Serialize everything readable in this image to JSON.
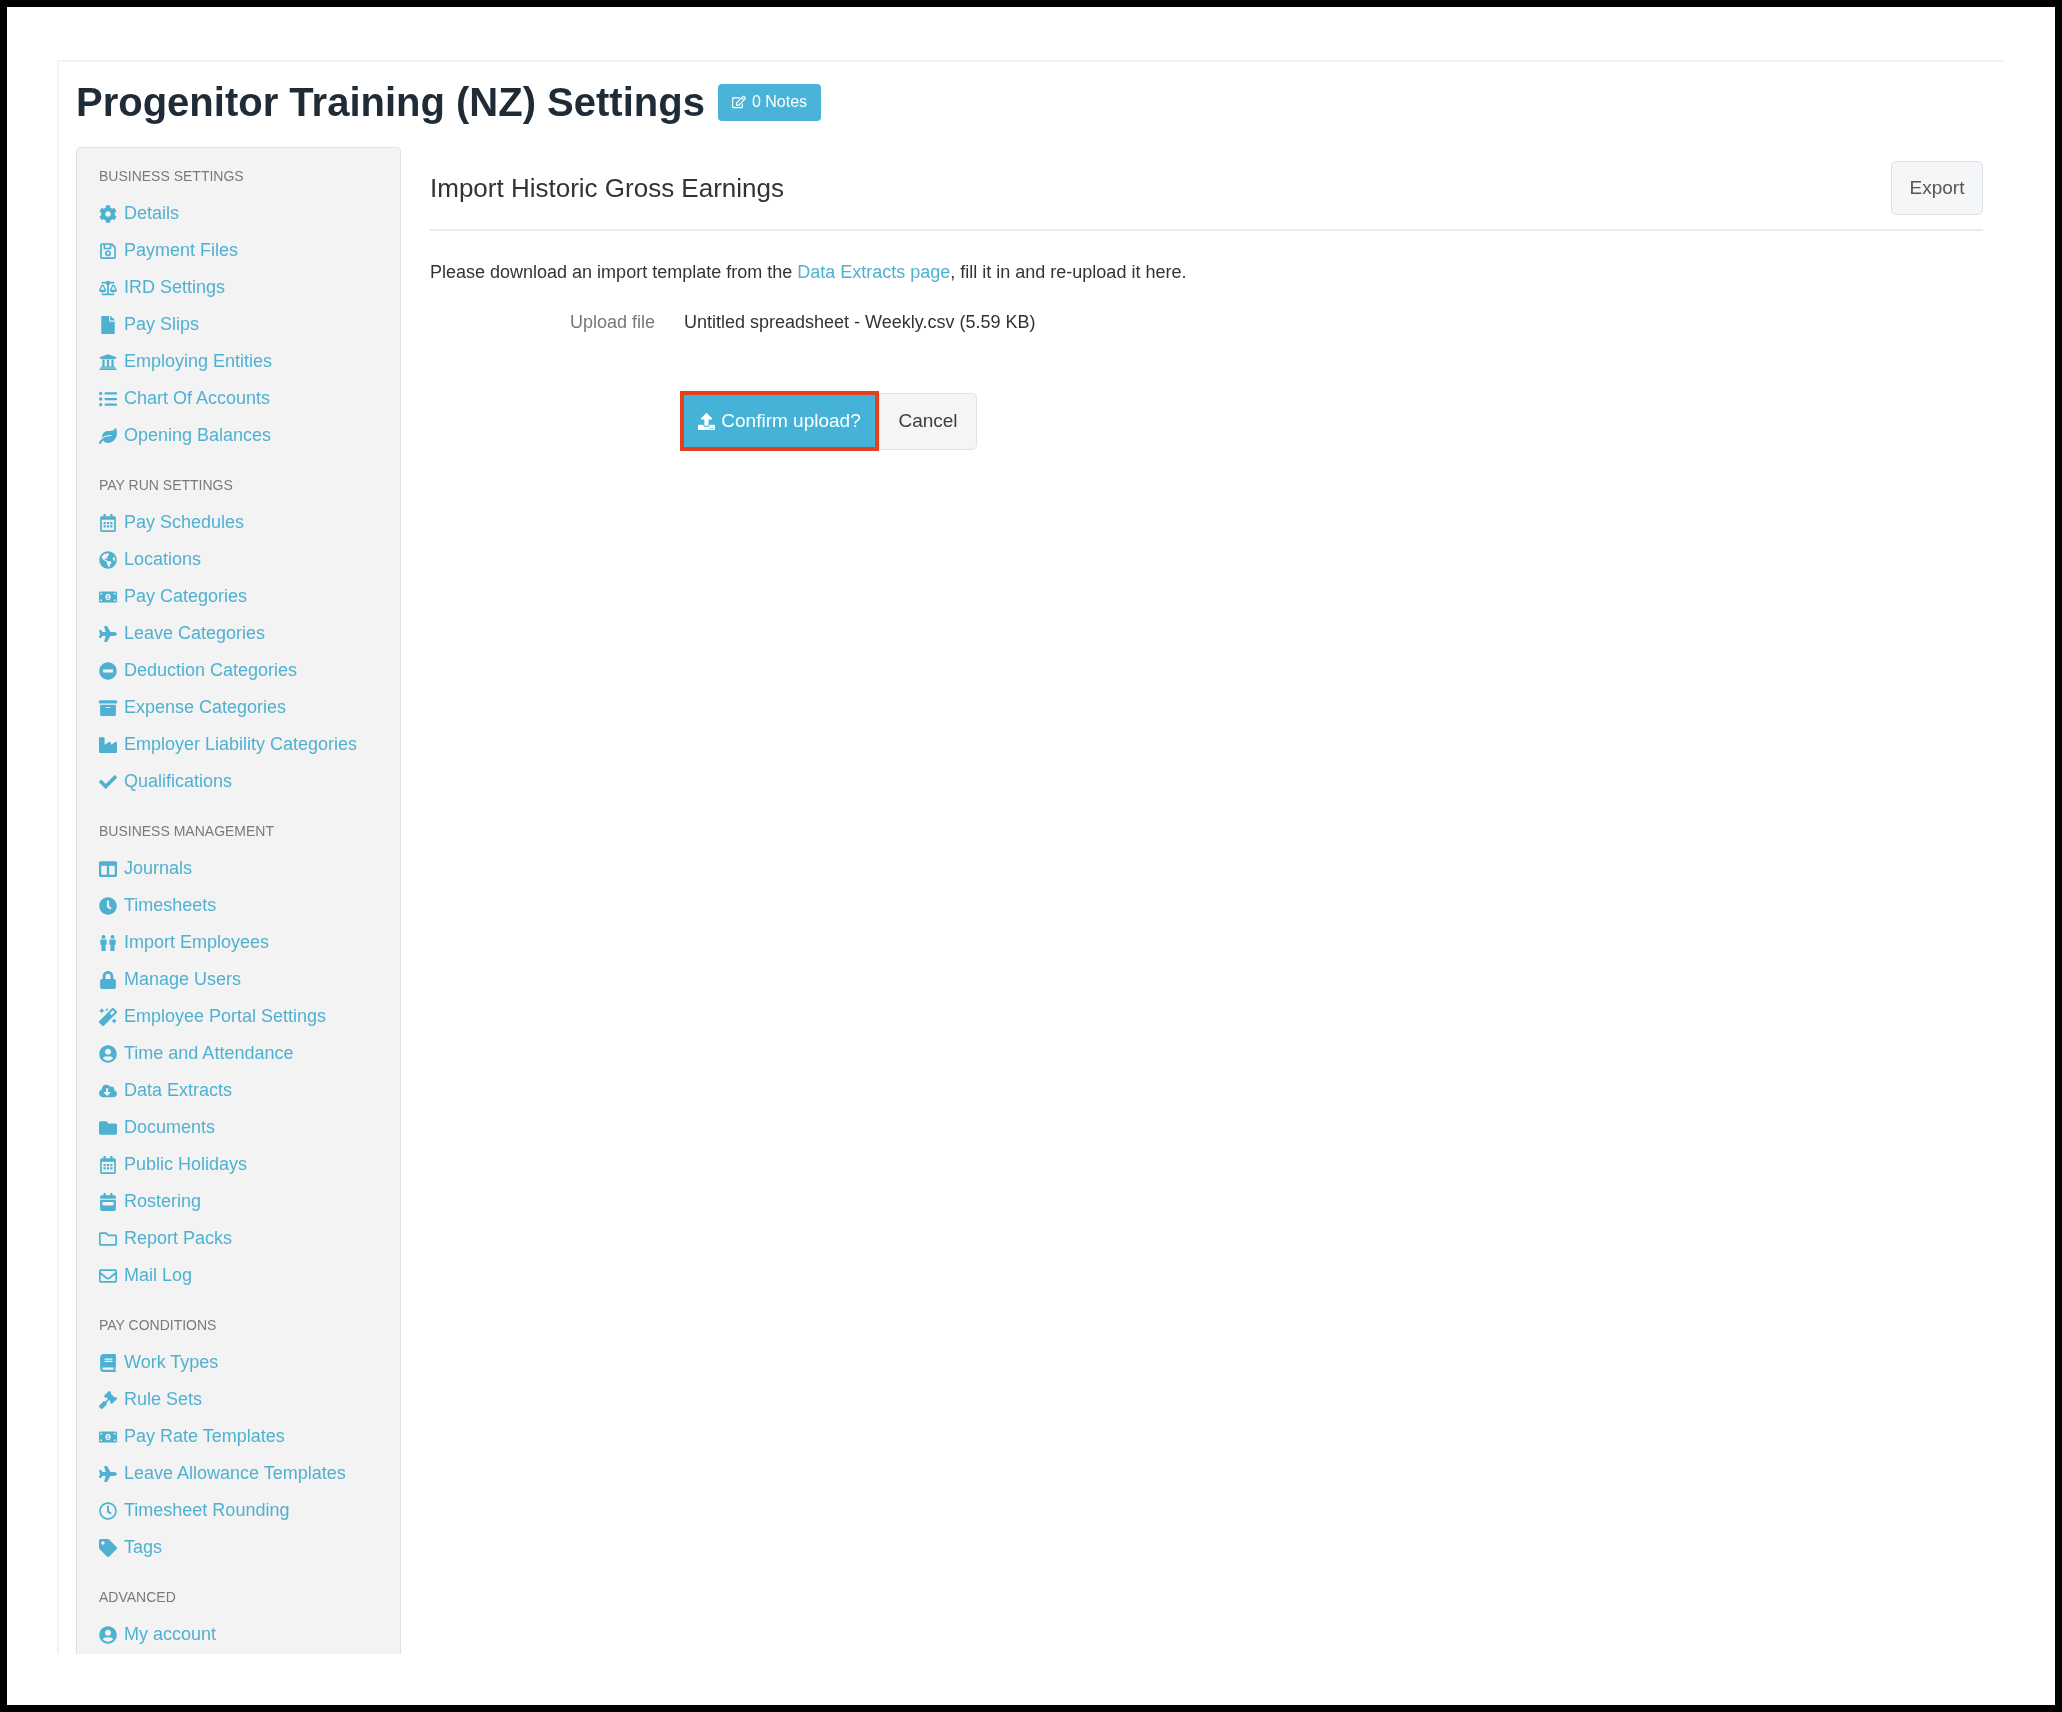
{
  "page": {
    "title": "Progenitor Training (NZ) Settings",
    "notes_badge": "0 Notes"
  },
  "sidebar": {
    "sections": [
      {
        "heading": "BUSINESS SETTINGS",
        "items": [
          {
            "label": "Details"
          },
          {
            "label": "Payment Files"
          },
          {
            "label": "IRD Settings"
          },
          {
            "label": "Pay Slips"
          },
          {
            "label": "Employing Entities"
          },
          {
            "label": "Chart Of Accounts"
          },
          {
            "label": "Opening Balances"
          }
        ]
      },
      {
        "heading": "PAY RUN SETTINGS",
        "items": [
          {
            "label": "Pay Schedules"
          },
          {
            "label": "Locations"
          },
          {
            "label": "Pay Categories"
          },
          {
            "label": "Leave Categories"
          },
          {
            "label": "Deduction Categories"
          },
          {
            "label": "Expense Categories"
          },
          {
            "label": "Employer Liability Categories"
          },
          {
            "label": "Qualifications"
          }
        ]
      },
      {
        "heading": "BUSINESS MANAGEMENT",
        "items": [
          {
            "label": "Journals"
          },
          {
            "label": "Timesheets"
          },
          {
            "label": "Import Employees"
          },
          {
            "label": "Manage Users"
          },
          {
            "label": "Employee Portal Settings"
          },
          {
            "label": "Time and Attendance"
          },
          {
            "label": "Data Extracts"
          },
          {
            "label": "Documents"
          },
          {
            "label": "Public Holidays"
          },
          {
            "label": "Rostering"
          },
          {
            "label": "Report Packs"
          },
          {
            "label": "Mail Log"
          }
        ]
      },
      {
        "heading": "PAY CONDITIONS",
        "items": [
          {
            "label": "Work Types"
          },
          {
            "label": "Rule Sets"
          },
          {
            "label": "Pay Rate Templates"
          },
          {
            "label": "Leave Allowance Templates"
          },
          {
            "label": "Timesheet Rounding"
          },
          {
            "label": "Tags"
          }
        ]
      },
      {
        "heading": "ADVANCED",
        "items": [
          {
            "label": "My account"
          }
        ]
      }
    ]
  },
  "panel": {
    "title": "Import Historic Gross Earnings",
    "export_button": "Export",
    "instructions": {
      "before": "Please download an import template from the ",
      "link": "Data Extracts page",
      "after": ", fill it in and re-upload it here."
    },
    "upload_file": {
      "label": "Upload file",
      "value": "Untitled spreadsheet - Weekly.csv (5.59 KB)"
    },
    "actions": [
      {
        "kind": "primary",
        "label": "Confirm upload?",
        "highlighted": true
      },
      {
        "kind": "secondary",
        "label": "Cancel",
        "highlighted": false
      }
    ]
  }
}
